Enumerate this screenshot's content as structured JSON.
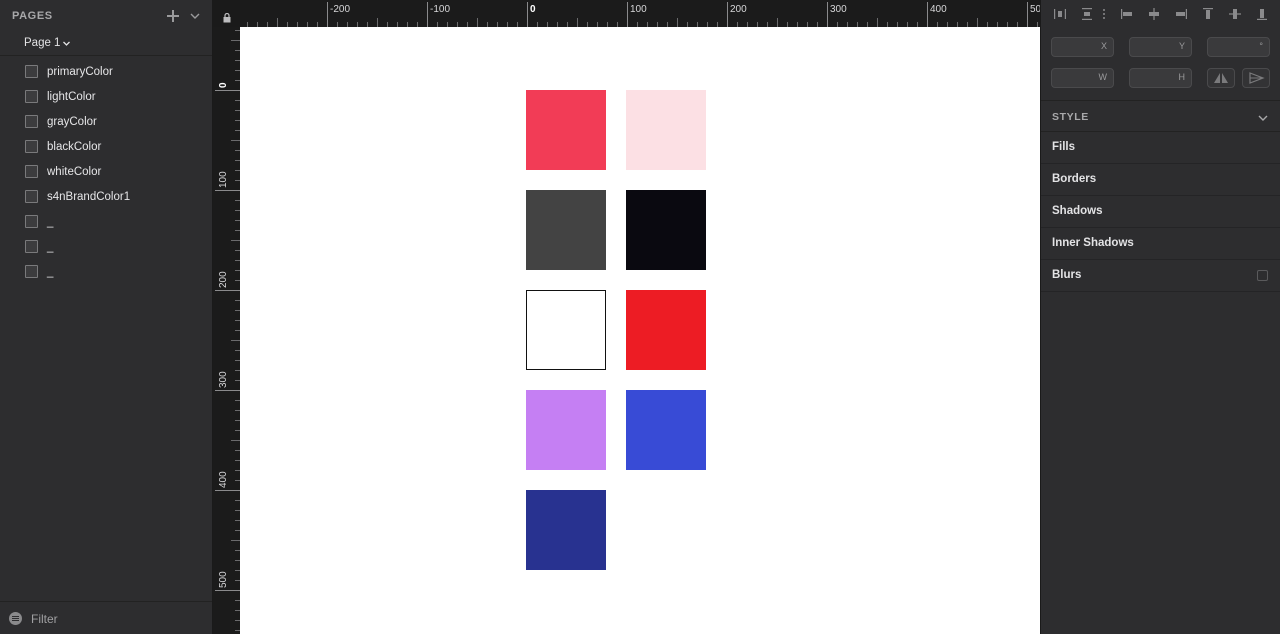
{
  "sidebar": {
    "pages_title": "PAGES",
    "current_page": "Page 1",
    "layers": [
      {
        "label": "primaryColor"
      },
      {
        "label": "lightColor"
      },
      {
        "label": "grayColor"
      },
      {
        "label": "blackColor"
      },
      {
        "label": "whiteColor"
      },
      {
        "label": "s4nBrandColor1"
      },
      {
        "label": "_"
      },
      {
        "label": "_"
      },
      {
        "label": "_"
      }
    ],
    "filter_label": "Filter"
  },
  "rulers": {
    "top_labels": [
      "-200",
      "-100",
      "0",
      "100",
      "200",
      "300",
      "400",
      "50"
    ],
    "left_labels": [
      "0",
      "100",
      "200",
      "300",
      "400",
      "500"
    ]
  },
  "canvas": {
    "swatches": [
      {
        "name": "primaryColor",
        "color": "#f23c56"
      },
      {
        "name": "lightColor",
        "color": "#fce0e4"
      },
      {
        "name": "grayColor",
        "color": "#434343"
      },
      {
        "name": "blackColor",
        "color": "#0a0910"
      },
      {
        "name": "whiteColor",
        "color": "#ffffff"
      },
      {
        "name": "s4nBrandColor1",
        "color": "#ed1c24"
      },
      {
        "name": "_",
        "color": "#c57ff3"
      },
      {
        "name": "_",
        "color": "#384bd6"
      },
      {
        "name": "_",
        "color": "#283290"
      }
    ]
  },
  "inspector": {
    "fields": {
      "x_suffix": "X",
      "y_suffix": "Y",
      "rotation_suffix": "°",
      "w_suffix": "W",
      "h_suffix": "H"
    },
    "style_title": "STYLE",
    "properties": [
      "Fills",
      "Borders",
      "Shadows",
      "Inner Shadows",
      "Blurs"
    ]
  }
}
